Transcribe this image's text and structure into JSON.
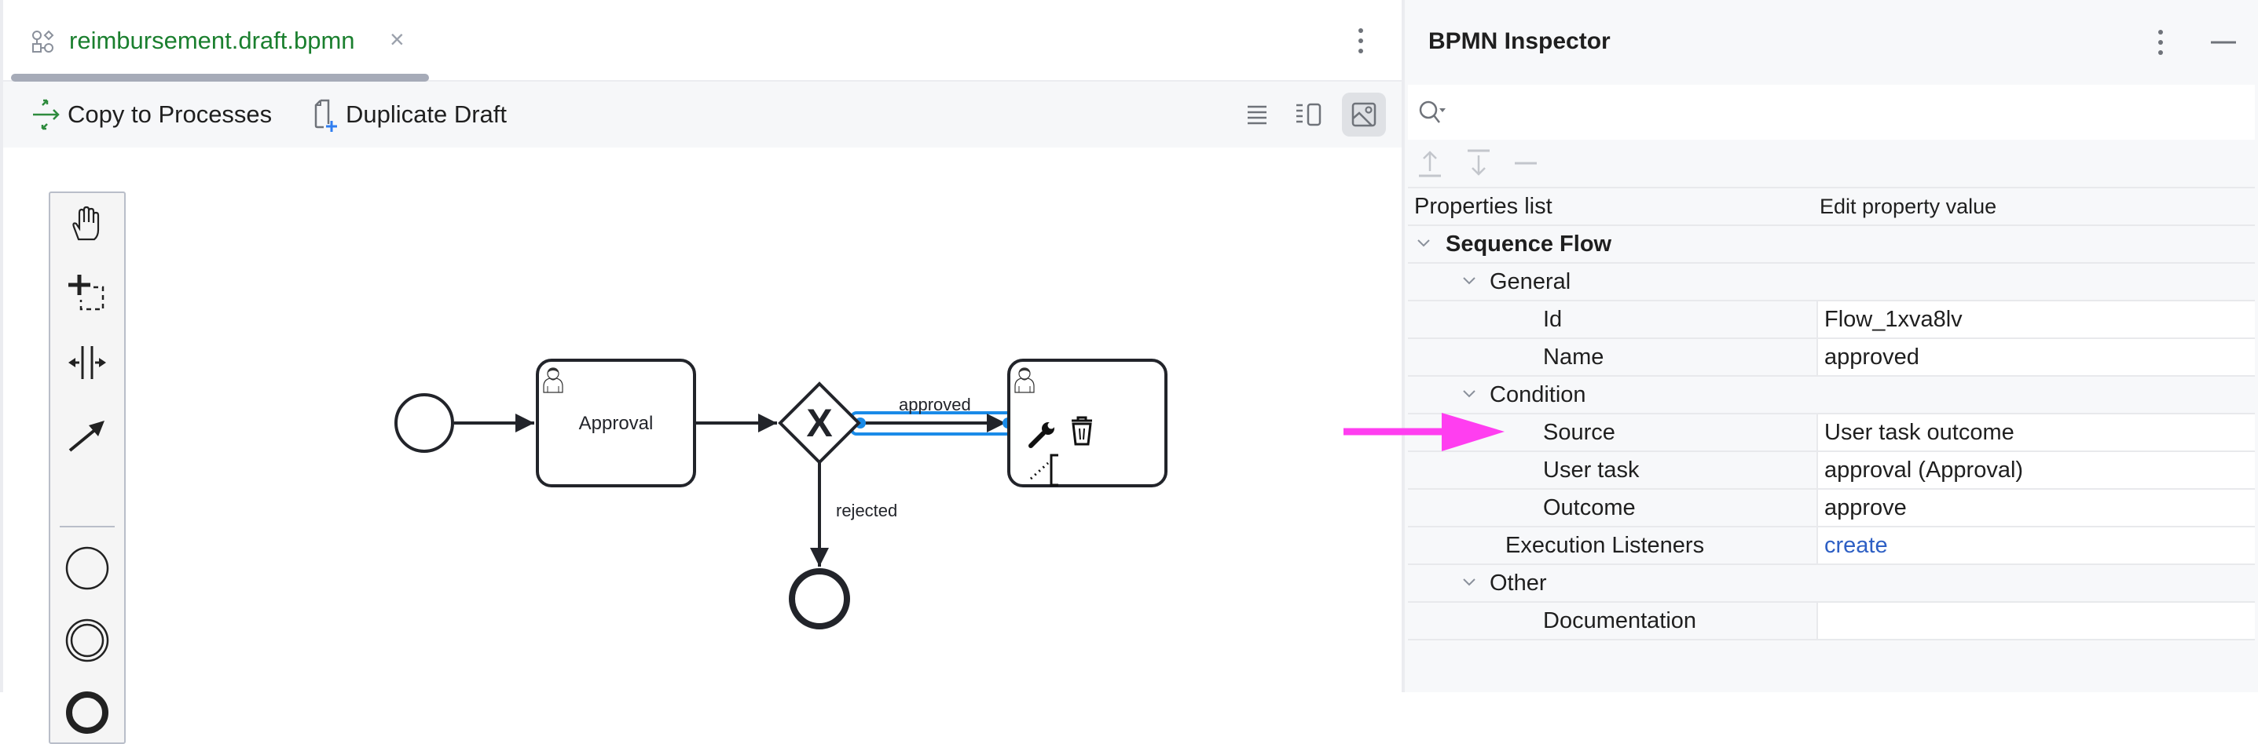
{
  "editor": {
    "tab": {
      "title": "reimbursement.draft.bpmn",
      "icon": "bpmn-file-icon",
      "close_label": "×",
      "title_color": "#1a7f2e"
    },
    "toolbar": {
      "copy_to_processes": "Copy to Processes",
      "duplicate_draft": "Duplicate Draft",
      "view_modes": [
        {
          "name": "text-view",
          "icon": "list-lines-icon",
          "active": false
        },
        {
          "name": "split-view",
          "icon": "split-view-icon",
          "active": false
        },
        {
          "name": "diagram-view",
          "icon": "image-preview-icon",
          "active": true
        }
      ]
    },
    "palette": {
      "tools": [
        "hand-tool",
        "lasso-tool",
        "space-tool",
        "global-connect-tool"
      ],
      "elements": [
        "create-start-event",
        "create-intermediate-event",
        "create-end-event"
      ]
    },
    "diagram": {
      "nodes": [
        {
          "id": "start",
          "type": "start-event",
          "label": ""
        },
        {
          "id": "approval",
          "type": "user-task",
          "label": "Approval"
        },
        {
          "id": "gateway",
          "type": "exclusive-gateway",
          "label": ""
        },
        {
          "id": "task2",
          "type": "user-task",
          "label": ""
        },
        {
          "id": "end",
          "type": "end-event",
          "label": ""
        }
      ],
      "flows": [
        {
          "from": "start",
          "to": "approval",
          "label": ""
        },
        {
          "from": "approval",
          "to": "gateway",
          "label": ""
        },
        {
          "from": "gateway",
          "to": "task2",
          "label": "approved",
          "selected": true
        },
        {
          "from": "gateway",
          "to": "end",
          "label": "rejected"
        }
      ],
      "gateway_marker": "X",
      "selection_color": "#1a8be8"
    }
  },
  "inspector": {
    "title": "BPMN Inspector",
    "search": {
      "placeholder": "",
      "value": ""
    },
    "columns": {
      "name": "Properties list",
      "value": "Edit property value"
    },
    "rows": [
      {
        "kind": "section",
        "level": 0,
        "label": "Sequence Flow",
        "bold": true
      },
      {
        "kind": "section",
        "level": 1,
        "label": "General"
      },
      {
        "kind": "prop",
        "level": 2,
        "label": "Id",
        "value": "Flow_1xva8lv"
      },
      {
        "kind": "prop",
        "level": 2,
        "label": "Name",
        "value": "approved"
      },
      {
        "kind": "section",
        "level": 1,
        "label": "Condition"
      },
      {
        "kind": "prop",
        "level": 2,
        "label": "Source",
        "value": "User task outcome"
      },
      {
        "kind": "prop",
        "level": 2,
        "label": "User task",
        "value": "approval (Approval)"
      },
      {
        "kind": "prop",
        "level": 2,
        "label": "Outcome",
        "value": "approve"
      },
      {
        "kind": "link",
        "level": 1.6,
        "label": "Execution Listeners",
        "value": "create"
      },
      {
        "kind": "section",
        "level": 1,
        "label": "Other"
      },
      {
        "kind": "prop",
        "level": 2,
        "label": "Documentation",
        "value": ""
      }
    ],
    "link_color": "#2d5fc4"
  },
  "annotation": {
    "arrow_color": "#ff3ef0",
    "points_to": "Source"
  }
}
